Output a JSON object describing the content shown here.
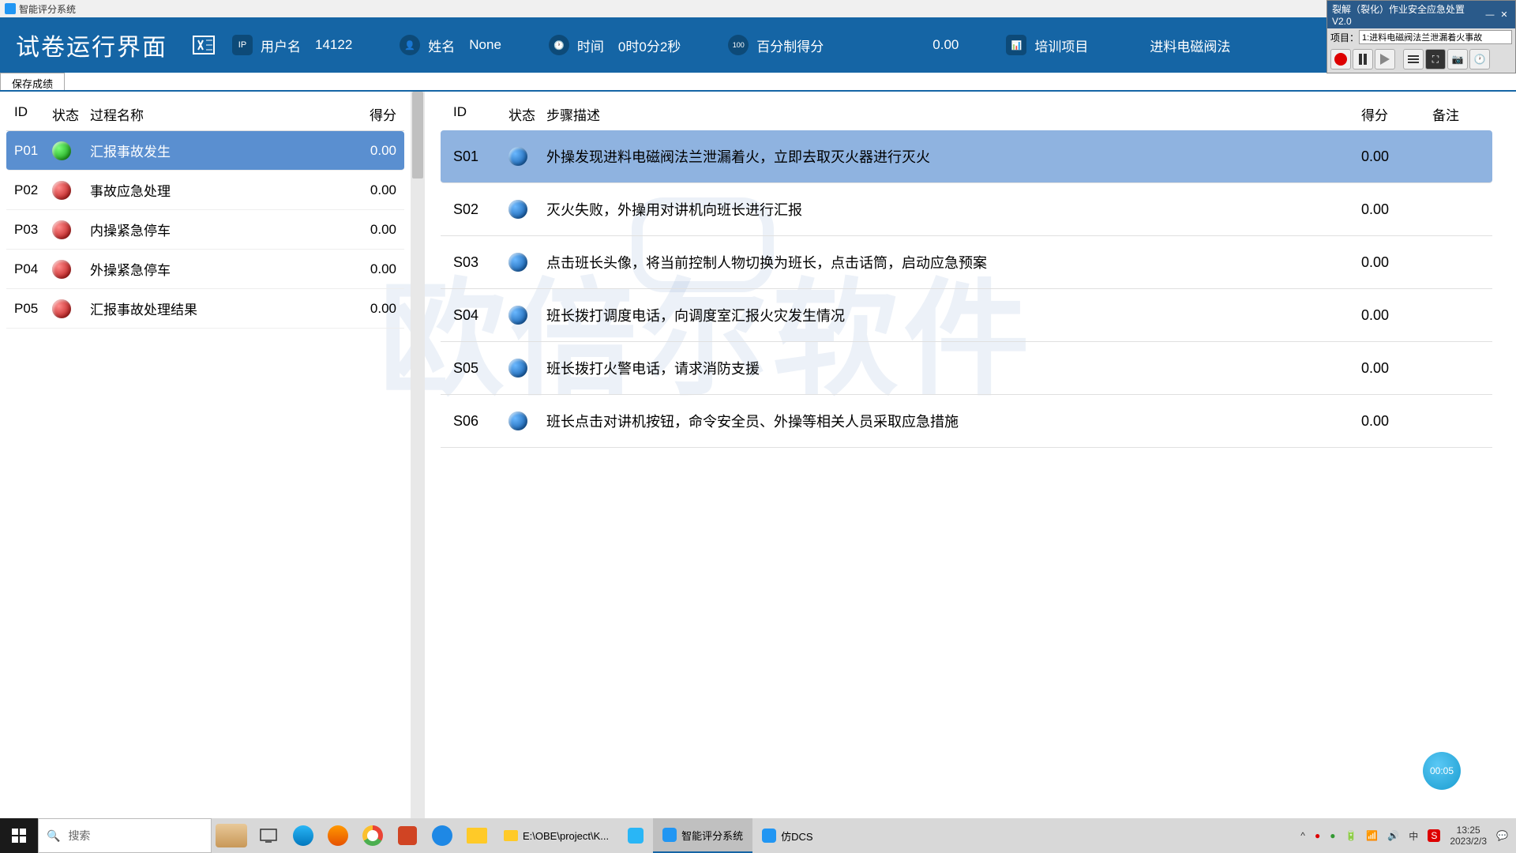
{
  "titlebar": {
    "text": "智能评分系统"
  },
  "header": {
    "app_title": "试卷运行界面",
    "user_label": "用户名",
    "user_value": "14122",
    "name_label": "姓名",
    "name_value": "None",
    "time_label": "时间",
    "time_value": "0时0分2秒",
    "score_label": "百分制得分",
    "score_value": "0.00",
    "train_label": "培训项目",
    "train_value": "进料电磁阀法"
  },
  "toolbar": {
    "save_label": "保存成绩"
  },
  "left": {
    "col_id": "ID",
    "col_status": "状态",
    "col_name": "过程名称",
    "col_score": "得分",
    "rows": [
      {
        "id": "P01",
        "status": "green",
        "name": "汇报事故发生",
        "score": "0.00",
        "selected": true
      },
      {
        "id": "P02",
        "status": "red",
        "name": "事故应急处理",
        "score": "0.00",
        "selected": false
      },
      {
        "id": "P03",
        "status": "red",
        "name": "内操紧急停车",
        "score": "0.00",
        "selected": false
      },
      {
        "id": "P04",
        "status": "red",
        "name": "外操紧急停车",
        "score": "0.00",
        "selected": false
      },
      {
        "id": "P05",
        "status": "red",
        "name": "汇报事故处理结果",
        "score": "0.00",
        "selected": false
      }
    ]
  },
  "right": {
    "col_id": "ID",
    "col_status": "状态",
    "col_desc": "步骤描述",
    "col_score": "得分",
    "col_remark": "备注",
    "rows": [
      {
        "id": "S01",
        "desc": "外操发现进料电磁阀法兰泄漏着火，立即去取灭火器进行灭火",
        "score": "0.00",
        "selected": true
      },
      {
        "id": "S02",
        "desc": "灭火失败，外操用对讲机向班长进行汇报",
        "score": "0.00",
        "selected": false
      },
      {
        "id": "S03",
        "desc": "点击班长头像，将当前控制人物切换为班长，点击话筒，启动应急预案",
        "score": "0.00",
        "selected": false
      },
      {
        "id": "S04",
        "desc": "班长拨打调度电话，向调度室汇报火灾发生情况",
        "score": "0.00",
        "selected": false
      },
      {
        "id": "S05",
        "desc": "班长拨打火警电话，请求消防支援",
        "score": "0.00",
        "selected": false
      },
      {
        "id": "S06",
        "desc": "班长点击对讲机按钮，命令安全员、外操等相关人员采取应急措施",
        "score": "0.00",
        "selected": false
      }
    ]
  },
  "watermark": "欧倍尔软件",
  "float": {
    "title": "裂解（裂化）作业安全应急处置V2.0",
    "proj_label": "项目：",
    "proj_value": "1:进料电磁阀法兰泄漏着火事故"
  },
  "timer_bubble": "00:05",
  "taskbar": {
    "search_placeholder": "搜索",
    "apps": [
      {
        "label": "E:\\OBE\\project\\K...",
        "icon": "folder"
      },
      {
        "label": "",
        "icon": "blue"
      },
      {
        "label": "智能评分系统",
        "icon": "app",
        "active": true
      },
      {
        "label": "仿DCS",
        "icon": "app"
      }
    ],
    "ime": "中",
    "sogou": "S",
    "time": "13:25",
    "date": "2023/2/3"
  }
}
